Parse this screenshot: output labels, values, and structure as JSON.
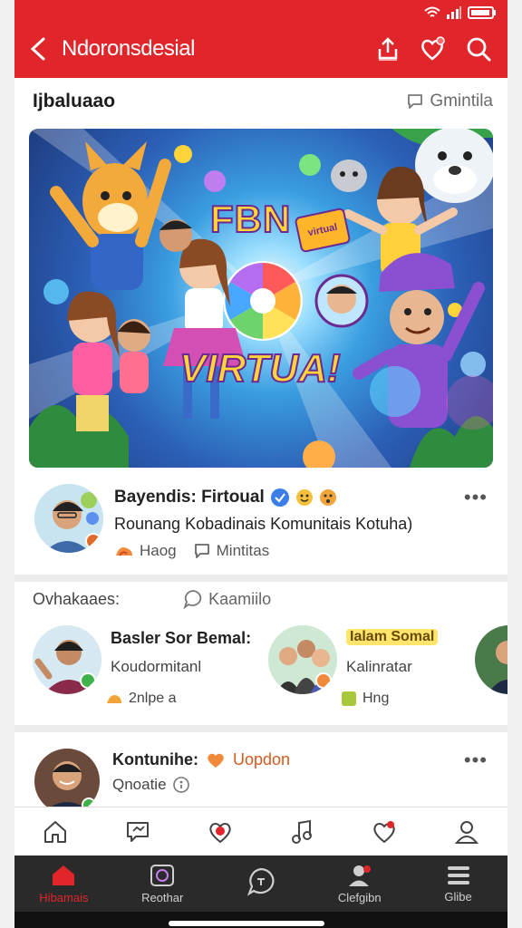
{
  "appbar": {
    "title": "Ndoronsdesial"
  },
  "section": {
    "title": "Ijbaluaao",
    "link": "Gmintila"
  },
  "banner": {
    "title": "FBN",
    "subtitle": "VIRTUA!",
    "badge": "virtual"
  },
  "post": {
    "name": "Bayendis: Firtoual",
    "description": "Rounang Kobadinais Komunitais Kotuha)",
    "meta_like": "Haog",
    "meta_comment": "Mintitas"
  },
  "community": {
    "label": "Ovhakaaes:",
    "link": "Kaamiilo",
    "cards": [
      {
        "name": "Basler Sor Bemal:",
        "sub": "Koudormitanl",
        "tag": "2nlpe a",
        "highlight": false
      },
      {
        "name": "Ialam Somal",
        "sub": "Kalinratar",
        "tag": "Hng",
        "highlight": true
      }
    ]
  },
  "post2": {
    "name": "Kontunihe:",
    "tag": "Uopdon",
    "sub": "Qnoatie"
  },
  "bottomnav": {
    "items": [
      {
        "label": "Hibamais",
        "active": true
      },
      {
        "label": "Reothar",
        "active": false
      },
      {
        "label": "",
        "active": false
      },
      {
        "label": "Clefgibn",
        "active": false
      },
      {
        "label": "Glibe",
        "active": false
      }
    ]
  },
  "colors": {
    "accent": "#e0262b",
    "nav_bg": "#2a2a2a"
  },
  "icons": {
    "appbar": [
      "back-arrow-icon",
      "share-icon",
      "heart-badge-icon",
      "search-icon"
    ],
    "actionbar": [
      "home-icon",
      "chat-icon",
      "heart-icon",
      "music-icon",
      "heart-outline-icon",
      "profile-icon"
    ],
    "bottomnav": [
      "home-icon",
      "camera-icon",
      "chat-icon",
      "people-icon",
      "menu-icon"
    ]
  }
}
